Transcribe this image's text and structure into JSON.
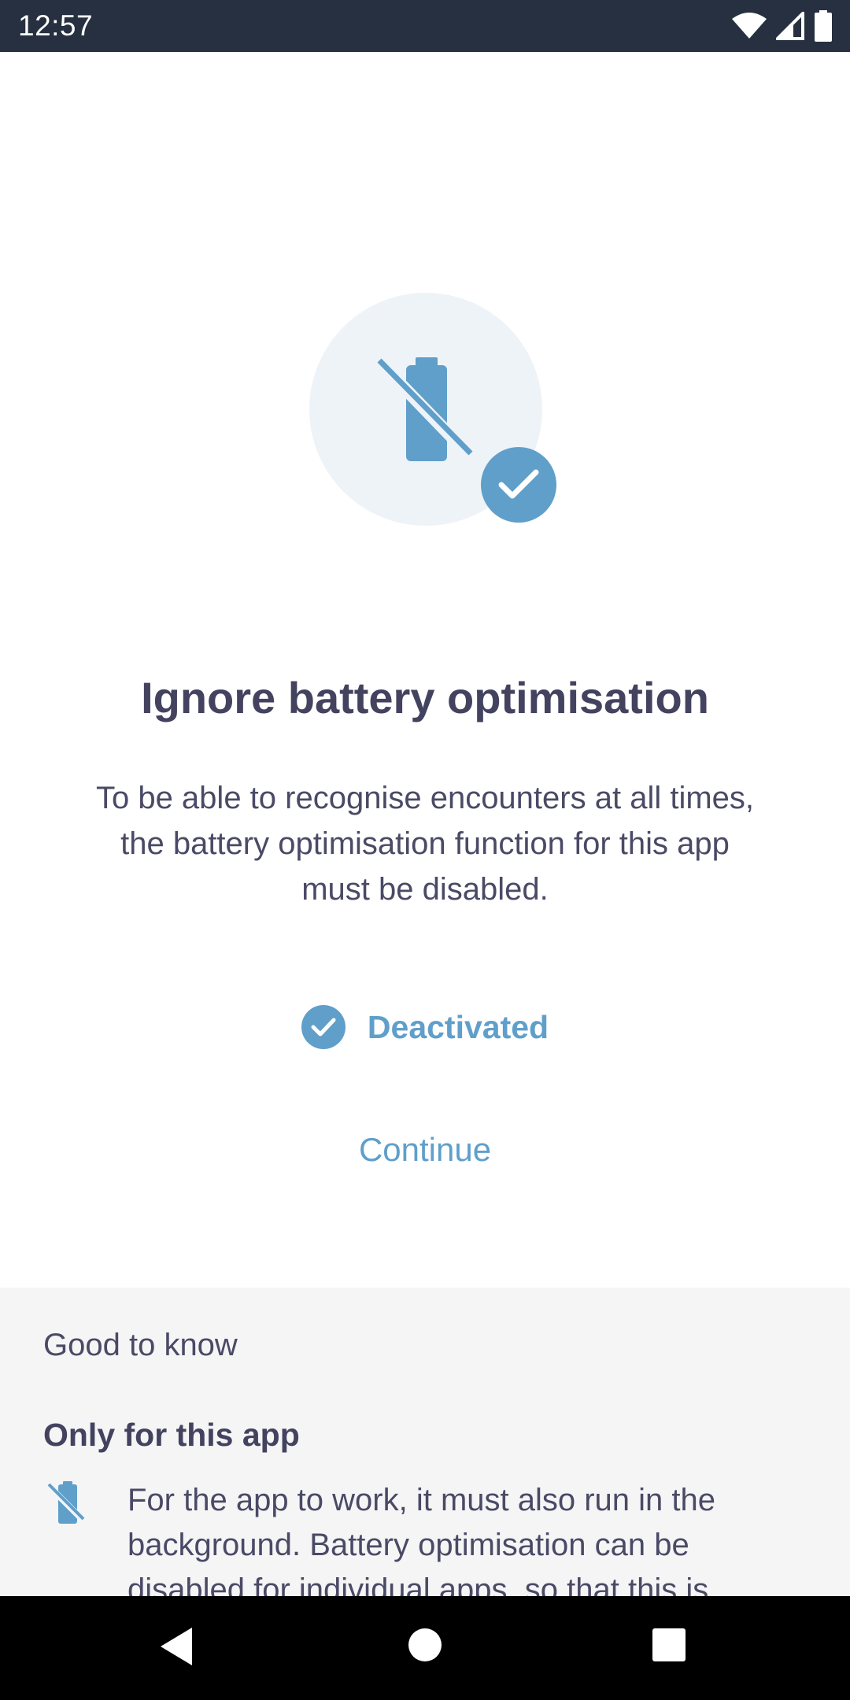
{
  "status_bar": {
    "time": "12:57"
  },
  "icons": {
    "wifi": "wifi-icon",
    "signal": "cellular-signal-icon",
    "battery": "battery-full-icon",
    "hero": "battery-optimisation-off-icon",
    "hero_check": "check-icon",
    "status_check": "check-circle-icon",
    "info": "battery-optimisation-off-icon"
  },
  "main": {
    "title": "Ignore battery optimisation",
    "description": "To be able to recognise encounters at all times, the battery optimisation function for this app must be disabled.",
    "status_label": "Deactivated",
    "continue_label": "Continue"
  },
  "info": {
    "heading": "Good to know",
    "subheading": "Only for this app",
    "text": "For the app to work, it must also run in the background. Battery optimisation can be disabled for individual apps, so that this is"
  },
  "colors": {
    "accent": "#5f9fca",
    "title": "#434360",
    "status_bar_bg": "#263040",
    "info_bg": "#f5f5f6",
    "hero_bg": "#eef3f8"
  },
  "nav_bar": {
    "back": "back-icon",
    "home": "home-icon",
    "recents": "recents-icon"
  }
}
